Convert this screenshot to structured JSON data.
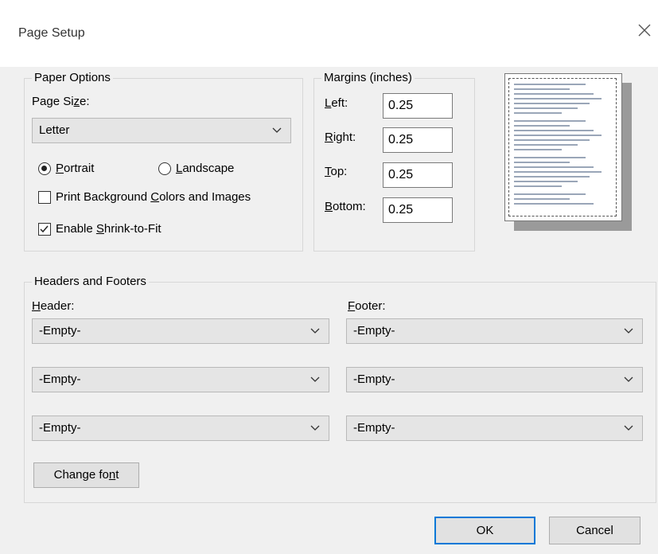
{
  "dialog": {
    "title": "Page Setup"
  },
  "paper_options": {
    "legend": "Paper Options",
    "page_size_label": "Page Size:",
    "page_size_value": "Letter",
    "portrait_label": "Portrait",
    "landscape_label": "Landscape",
    "orientation": "Portrait",
    "print_background_label": "Print Background Colors and Images",
    "print_background_checked": false,
    "shrink_to_fit_label": "Enable Shrink-to-Fit",
    "shrink_to_fit_checked": true
  },
  "margins": {
    "legend": "Margins (inches)",
    "left_label": "Left:",
    "left_value": "0.25",
    "right_label": "Right:",
    "right_value": "0.25",
    "top_label": "Top:",
    "top_value": "0.25",
    "bottom_label": "Bottom:",
    "bottom_value": "0.25"
  },
  "headers_footers": {
    "legend": "Headers and Footers",
    "header_label": "Header:",
    "footer_label": "Footer:",
    "header_values": [
      "-Empty-",
      "-Empty-",
      "-Empty-"
    ],
    "footer_values": [
      "-Empty-",
      "-Empty-",
      "-Empty-"
    ],
    "change_font_label": "Change font"
  },
  "buttons": {
    "ok": "OK",
    "cancel": "Cancel"
  },
  "colors": {
    "accent": "#0078d7",
    "dialog_bg": "#f0f0f0"
  }
}
